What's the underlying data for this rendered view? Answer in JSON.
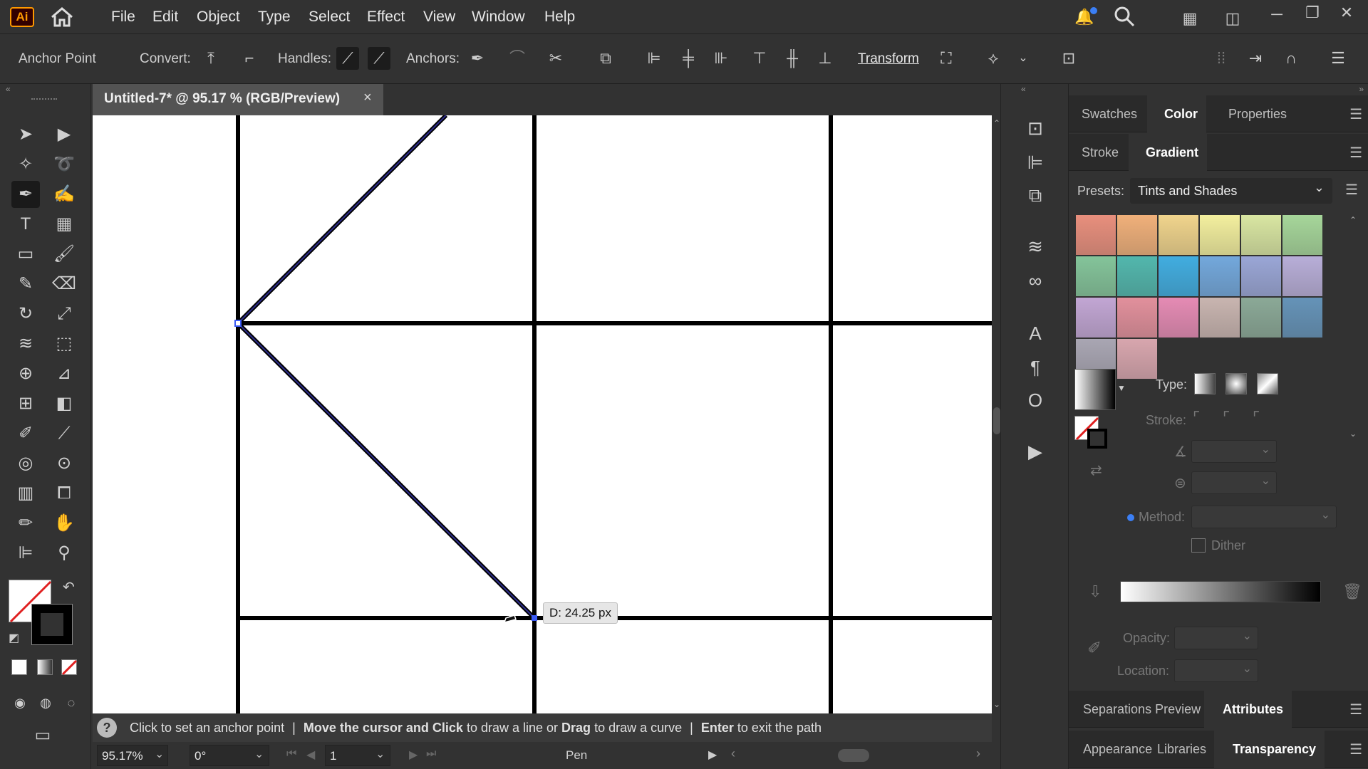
{
  "app": {
    "logo": "Ai"
  },
  "menubar": {
    "items": [
      "File",
      "Edit",
      "Object",
      "Type",
      "Select",
      "Effect",
      "View",
      "Window",
      "Help"
    ]
  },
  "control": {
    "title": "Anchor Point",
    "convert": "Convert:",
    "handles": "Handles:",
    "anchors": "Anchors:",
    "transform": "Transform"
  },
  "document": {
    "tab_title": "Untitled-7* @ 95.17 % (RGB/Preview)",
    "close": "×"
  },
  "canvas": {
    "tooltip": "D: 24.25 px"
  },
  "status": {
    "help_icon": "?",
    "s1": "Click to set an anchor point",
    "sep": "|",
    "s2a": "Move the cursor and",
    "s2b": "Click",
    "s2c": "to draw a line or",
    "s2d": "Drag",
    "s2e": "to draw a curve",
    "s3a": "Enter",
    "s3b": "to exit the path"
  },
  "bottom": {
    "zoom": "95.17%",
    "rotation": "0°",
    "artboard": "1",
    "tool": "Pen"
  },
  "panels": {
    "top_tabs": [
      "Swatches",
      "Color",
      "Properties"
    ],
    "gradient_tabs": [
      "Stroke",
      "Gradient"
    ],
    "presets_label": "Presets:",
    "presets_value": "Tints and Shades",
    "type_label": "Type:",
    "stroke_label": "Stroke:",
    "method_label": "Method:",
    "dither_label": "Dither",
    "opacity_label": "Opacity:",
    "location_label": "Location:",
    "sep_tabs": [
      "Separations Preview",
      "Attributes"
    ],
    "app_tabs": [
      "Appearance",
      "Libraries",
      "Transparency"
    ]
  },
  "swatches": [
    "#e88f7d",
    "#f0b07a",
    "#f0d48c",
    "#f3ef9e",
    "#d9e6a2",
    "#a6d69a",
    "#84c49a",
    "#52b7ad",
    "#41ade0",
    "#73a8dc",
    "#9aa6d6",
    "#b8aed8",
    "#c2a6d4",
    "#e2909c",
    "#e58bb4",
    "#c9b5b0",
    "#8ba997",
    "#6593b8",
    "#a9a6b3",
    "#d8a6ae"
  ],
  "colors": {
    "bg": "#323232",
    "canvas": "#535353",
    "path": "#1b1b6b",
    "accent": "#3b7ff5"
  }
}
